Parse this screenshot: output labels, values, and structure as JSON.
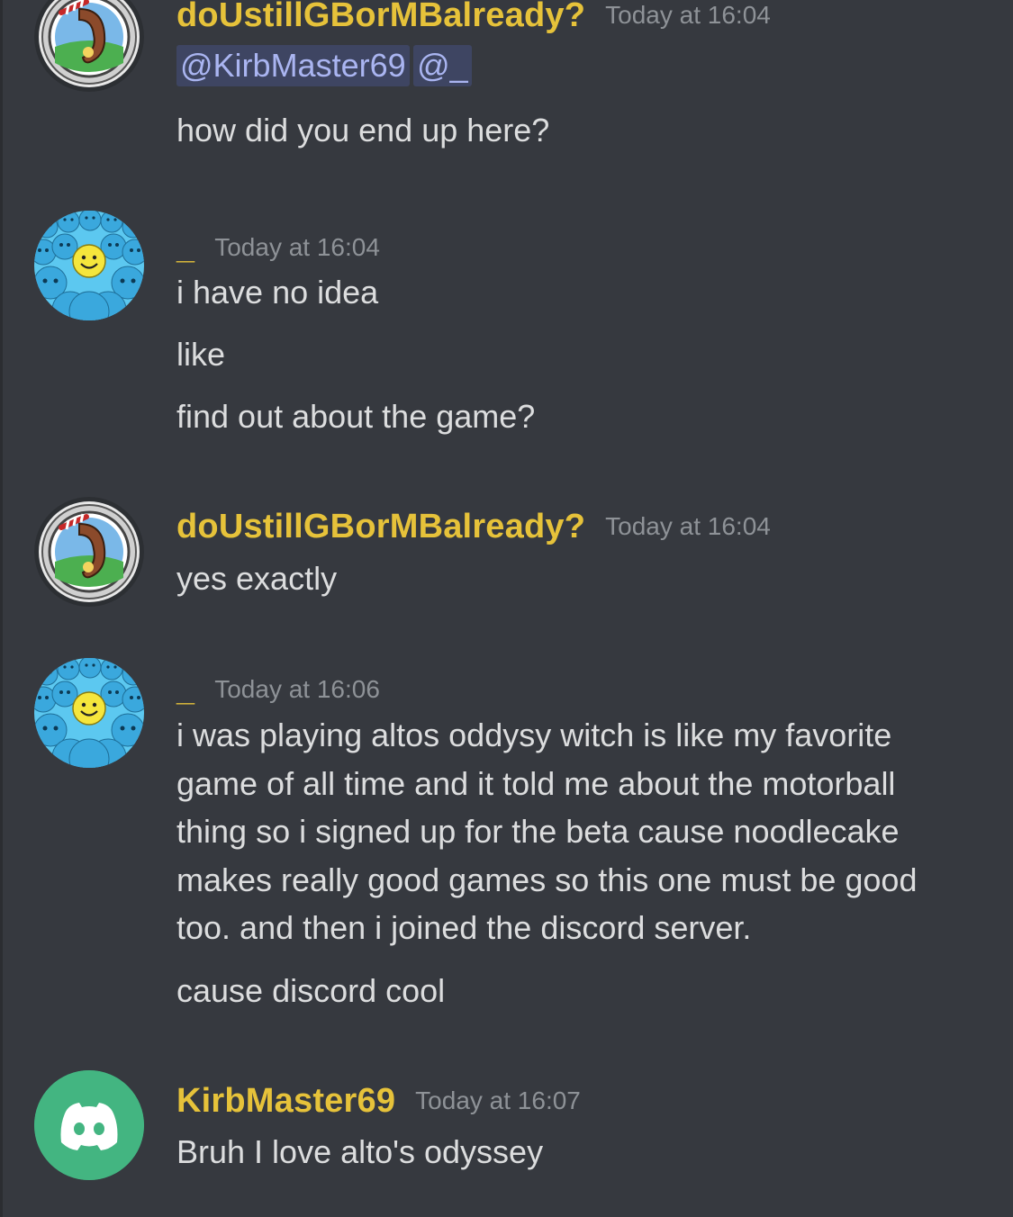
{
  "messages": [
    {
      "author": "doUstillGBorMBalready?",
      "avatar": "candy-cane-gear-avatar",
      "timestamp": "Today at 16:04",
      "mentions": [
        "@KirbMaster69",
        "@_"
      ],
      "lines": [
        "how did you end up here?"
      ]
    },
    {
      "author": "_",
      "avatar": "smiley-crowd-avatar",
      "timestamp": "Today at 16:04",
      "lines": [
        "i have no idea",
        "like",
        "find out about the game?"
      ]
    },
    {
      "author": "doUstillGBorMBalready?",
      "avatar": "candy-cane-gear-avatar",
      "timestamp": "Today at 16:04",
      "lines": [
        "yes exactly"
      ]
    },
    {
      "author": "_",
      "avatar": "smiley-crowd-avatar",
      "timestamp": "Today at 16:06",
      "paragraph": [
        "i was playing altos oddysy witch is like my favorite",
        "game of all time and it told me about the motorball",
        "thing so i signed up for the beta cause noodlecake",
        "makes really good games so this one must be good",
        "too. and then i joined the discord server."
      ],
      "lines": [
        "cause discord cool"
      ]
    },
    {
      "author": "KirbMaster69",
      "avatar": "discord-default-avatar",
      "timestamp": "Today at 16:07",
      "lines": [
        "Bruh I love alto's odyssey"
      ]
    }
  ],
  "colors": {
    "background": "#36393f",
    "username": "#e6c23a",
    "timestamp": "#8e9297",
    "text": "#dcddde",
    "mention_bg": "#3e4562",
    "mention_text": "#aab5f1",
    "discord_avatar": "#43b581"
  }
}
